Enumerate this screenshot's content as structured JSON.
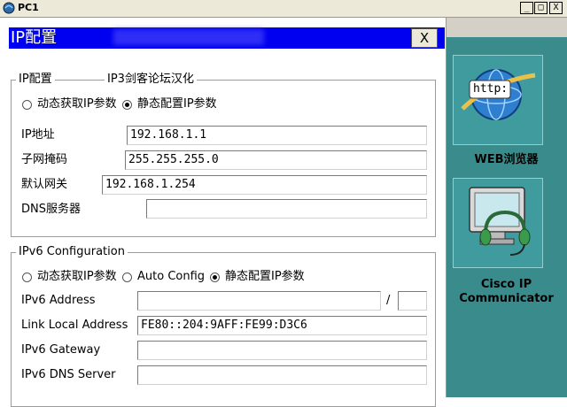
{
  "window": {
    "title": "PC1",
    "minimize": "_",
    "maximize": "□",
    "close": "X"
  },
  "dialog": {
    "title": "IP配置",
    "close_label": "X"
  },
  "ipv4": {
    "legend": "IP配置",
    "legend_extra": "IP3剑客论坛汉化",
    "radio_dhcp": "动态获取IP参数",
    "radio_static": "静态配置IP参数",
    "ip_label": "IP地址",
    "ip_value": "192.168.1.1",
    "mask_label": "子网掩码",
    "mask_value": "255.255.255.0",
    "gateway_label": "默认网关",
    "gateway_value": "192.168.1.254",
    "dns_label": "DNS服务器",
    "dns_value": ""
  },
  "ipv6": {
    "legend": "IPv6 Configuration",
    "radio_dhcp": "动态获取IP参数",
    "radio_auto": "Auto Config",
    "radio_static": "静态配置IP参数",
    "address_label": "IPv6 Address",
    "address_value": "",
    "prefix_sep": "/",
    "prefix_value": "",
    "link_local_label": "Link Local Address",
    "link_local_value": "FE80::204:9AFF:FE99:D3C6",
    "gateway_label": "IPv6 Gateway",
    "gateway_value": "",
    "dns_label": "IPv6 DNS Server",
    "dns_value": ""
  },
  "sidebar": {
    "web_browser_label": "WEB浏览器",
    "browser_icon_text": "http:",
    "communicator_label_1": "Cisco IP",
    "communicator_label_2": "Communicator"
  },
  "icons": {
    "app": "pc-icon",
    "browser": "web-browser-icon",
    "communicator": "ip-communicator-icon"
  }
}
